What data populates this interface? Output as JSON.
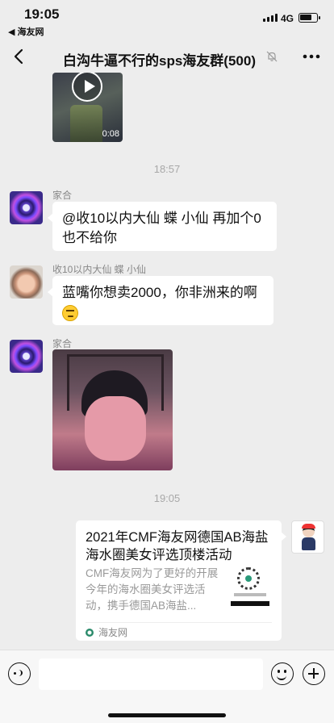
{
  "status_bar": {
    "time": "19:05",
    "back_app": "◀ 海友网",
    "network": "4G",
    "battery_fraction": 0.75
  },
  "nav": {
    "title": "白沟牛逼不行的sps海友群(500)",
    "icons": [
      "back-icon",
      "mute-bell-icon",
      "more-icon"
    ]
  },
  "messages": [
    {
      "type": "video",
      "duration": "0:08"
    },
    {
      "type": "time",
      "text": "18:57"
    },
    {
      "type": "text",
      "sender": "家合",
      "text": "@收10以内大仙 蝶 小仙 再加个0也不给你"
    },
    {
      "type": "text",
      "sender": "收10以内大仙 蝶 小仙",
      "text": "蓝嘴你想卖2000，你非洲来的啊",
      "emoji": "sweat-smile-emoji"
    },
    {
      "type": "image",
      "sender": "家合"
    },
    {
      "type": "time",
      "text": "19:05"
    },
    {
      "type": "link_card",
      "title": "2021年CMF海友网德国AB海盐海水圈美女评选顶楼活动",
      "description": "CMF海友网为了更好的开展今年的海水圈美女评选活动，携手德国AB海盐...",
      "source": "海友网"
    }
  ],
  "input_bar": {
    "icons": [
      "voice-icon",
      "emoji-icon",
      "plus-icon"
    ]
  },
  "colors": {
    "background": "#ededed",
    "bubble": "#ffffff",
    "meta_text": "#a8a8a8"
  }
}
